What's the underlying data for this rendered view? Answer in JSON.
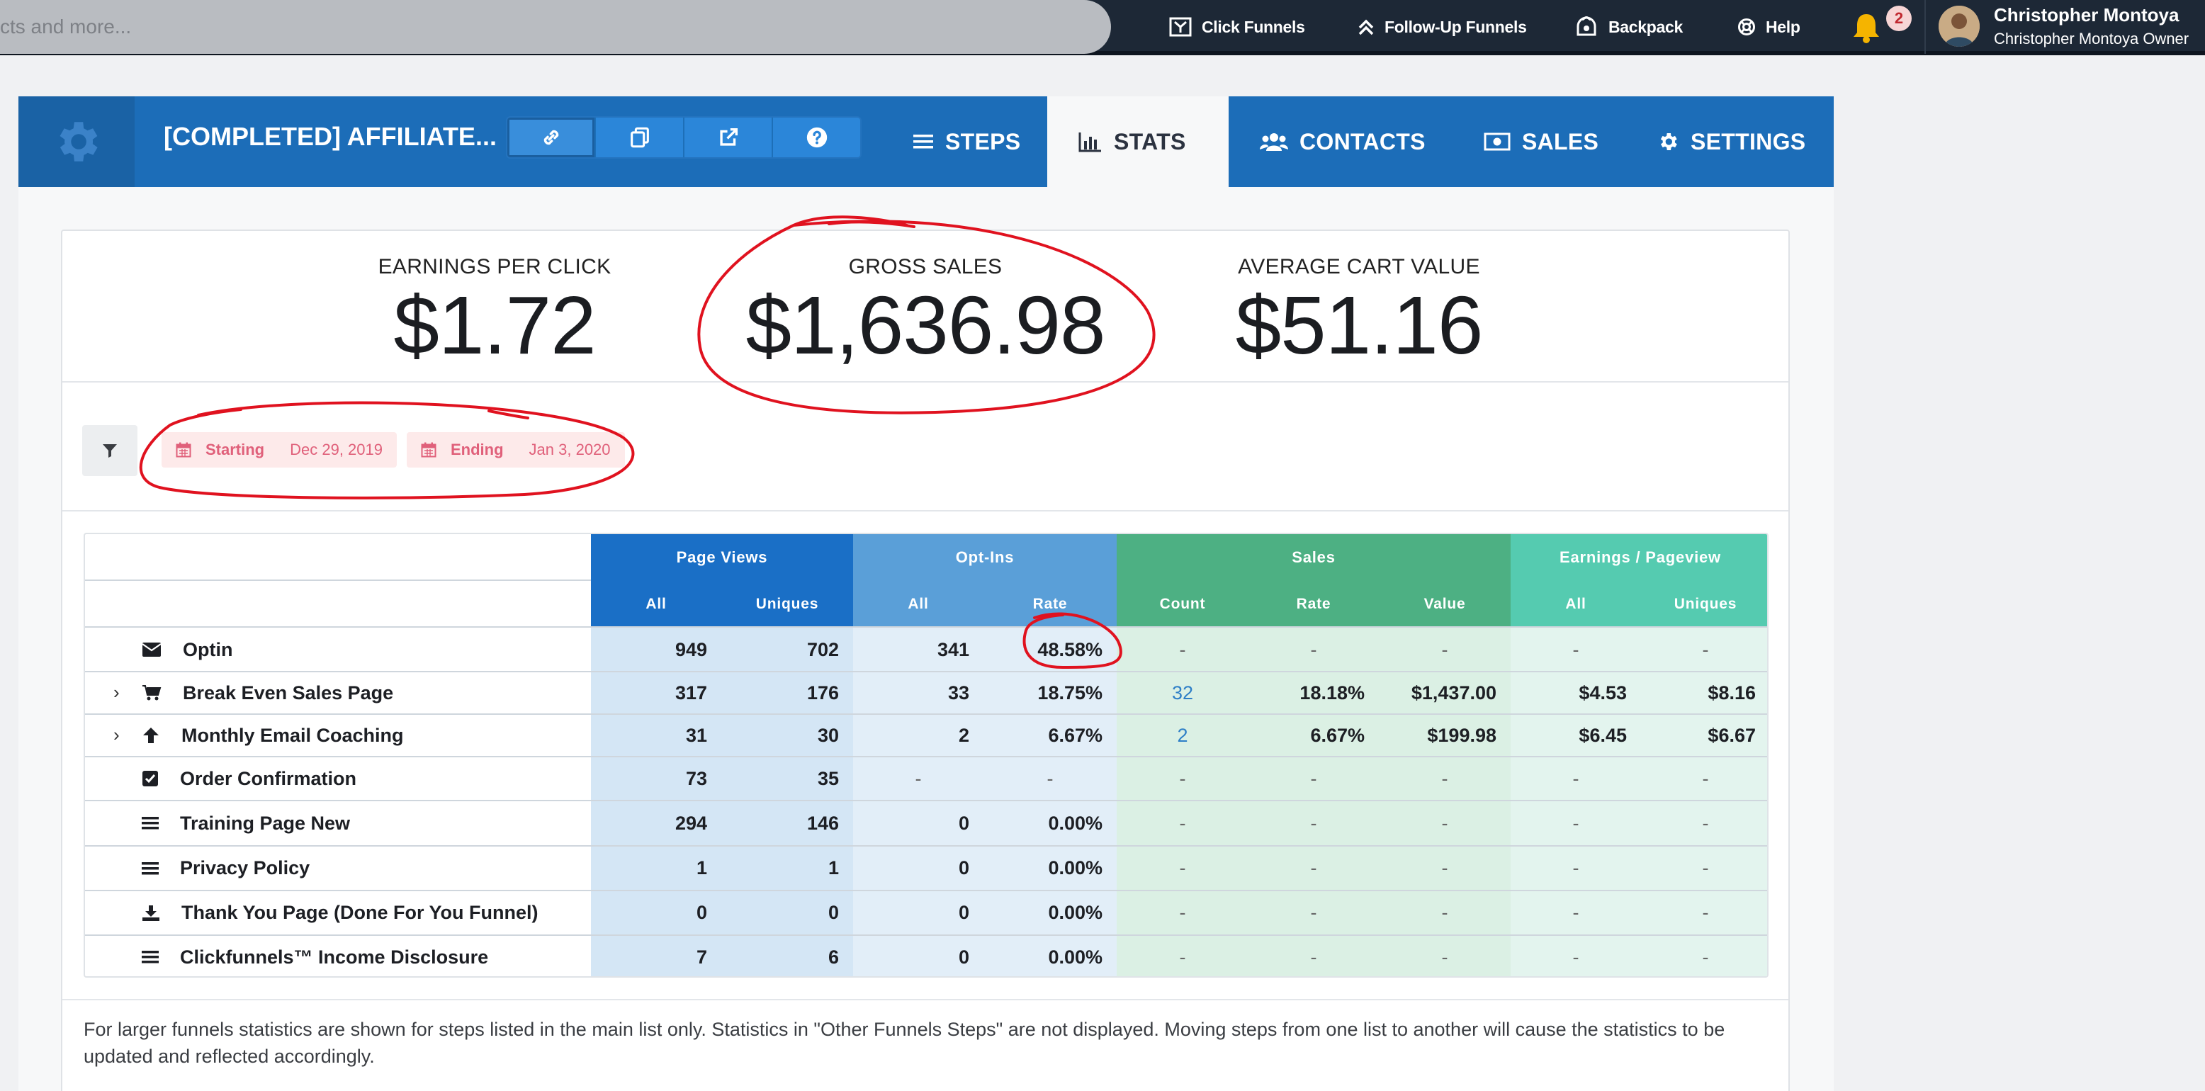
{
  "topnav": {
    "search_placeholder": "cts and more...",
    "links": [
      {
        "label": "Click Funnels",
        "icon": "clickfunnels-icon"
      },
      {
        "label": "Follow-Up Funnels",
        "icon": "chevrons-up-icon"
      },
      {
        "label": "Backpack",
        "icon": "backpack-icon"
      },
      {
        "label": "Help",
        "icon": "lifebuoy-icon"
      }
    ],
    "notification_count": "2",
    "user": {
      "name": "Christopher Montoya",
      "subtitle": "Christopher Montoya   Owner"
    }
  },
  "funnel": {
    "title": "[COMPLETED] AFFILIATE...",
    "tabs": [
      {
        "label": "STEPS",
        "icon": "list-icon"
      },
      {
        "label": "STATS",
        "icon": "bar-chart-icon",
        "active": true
      },
      {
        "label": "CONTACTS",
        "icon": "users-icon"
      },
      {
        "label": "SALES",
        "icon": "money-icon"
      },
      {
        "label": "SETTINGS",
        "icon": "gear-icon"
      }
    ]
  },
  "metrics": [
    {
      "label": "EARNINGS PER CLICK",
      "value": "$1.72"
    },
    {
      "label": "GROSS SALES",
      "value": "$1,636.98"
    },
    {
      "label": "AVERAGE CART VALUE",
      "value": "$51.16"
    }
  ],
  "filters": {
    "starting": {
      "label": "Starting",
      "value": "Dec 29, 2019"
    },
    "ending": {
      "label": "Ending",
      "value": "Jan 3, 2020"
    }
  },
  "table": {
    "groups": [
      "Page Views",
      "Opt-Ins",
      "Sales",
      "Earnings / Pageview"
    ],
    "subheaders": [
      "All",
      "Uniques",
      "All",
      "Rate",
      "Count",
      "Rate",
      "Value",
      "All",
      "Uniques"
    ],
    "rows": [
      {
        "name": "Optin",
        "icon": "envelope-icon",
        "expand": false,
        "cells": [
          "949",
          "702",
          "341",
          "48.58%",
          "-",
          "-",
          "-",
          "-",
          "-"
        ]
      },
      {
        "name": "Break Even Sales Page",
        "icon": "cart-icon",
        "expand": true,
        "cells": [
          "317",
          "176",
          "33",
          "18.75%",
          "32",
          "18.18%",
          "$1,437.00",
          "$4.53",
          "$8.16"
        ]
      },
      {
        "name": "Monthly Email Coaching",
        "icon": "arrow-up-icon",
        "expand": true,
        "cells": [
          "31",
          "30",
          "2",
          "6.67%",
          "2",
          "6.67%",
          "$199.98",
          "$6.45",
          "$6.67"
        ]
      },
      {
        "name": "Order Confirmation",
        "icon": "checkbox-icon",
        "expand": false,
        "cells": [
          "73",
          "35",
          "-",
          "-",
          "-",
          "-",
          "-",
          "-",
          "-"
        ]
      },
      {
        "name": "Training Page New",
        "icon": "menu-lines-icon",
        "expand": false,
        "cells": [
          "294",
          "146",
          "0",
          "0.00%",
          "-",
          "-",
          "-",
          "-",
          "-"
        ]
      },
      {
        "name": "Privacy Policy",
        "icon": "menu-lines-icon",
        "expand": false,
        "cells": [
          "1",
          "1",
          "0",
          "0.00%",
          "-",
          "-",
          "-",
          "-",
          "-"
        ]
      },
      {
        "name": "Thank You Page (Done For You Funnel)",
        "icon": "download-icon",
        "expand": false,
        "cells": [
          "0",
          "0",
          "0",
          "0.00%",
          "-",
          "-",
          "-",
          "-",
          "-"
        ]
      },
      {
        "name": "Clickfunnels™ Income Disclosure",
        "icon": "menu-lines-icon",
        "expand": false,
        "cells": [
          "7",
          "6",
          "0",
          "0.00%",
          "-",
          "-",
          "-",
          "-",
          "-"
        ]
      }
    ]
  },
  "footnote": "For larger funnels statistics are shown for steps listed in the main list only. Statistics in \"Other Funnels Steps\" are not displayed. Moving steps from one list to another will cause the statistics to be updated and reflected accordingly.",
  "colors": {
    "nav_bg": "#1d2836",
    "funnel_bar": "#1c6db8",
    "pageviews_header": "#1a6fc6",
    "optins_header": "#5a9fd8",
    "sales_header": "#4db083",
    "earnings_header": "#55cbb0",
    "annotation": "#e0121f"
  }
}
